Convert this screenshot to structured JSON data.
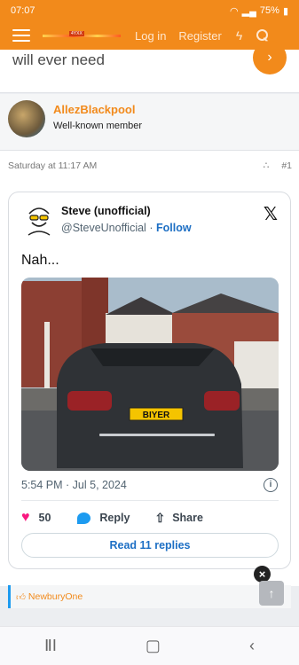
{
  "status": {
    "time": "07:07",
    "battery": "75%"
  },
  "header": {
    "login": "Log in",
    "register": "Register",
    "logo_tag": "4YXX"
  },
  "previous_post": {
    "text": "will ever need"
  },
  "post": {
    "author": "AllezBlackpool",
    "role": "Well-known member",
    "date": "Saturday at 11:17 AM",
    "number": "#1"
  },
  "tweet": {
    "name": "Steve (unofficial)",
    "handle": "@SteveUnofficial",
    "separator": "·",
    "follow": "Follow",
    "text": "Nah...",
    "plate": "BIYER",
    "timestamp": "5:54 PM · Jul 5, 2024",
    "likes": "50",
    "reply_label": "Reply",
    "share_label": "Share",
    "read_replies": "Read 11 replies"
  },
  "reactions": {
    "user": "NewburyOne"
  }
}
